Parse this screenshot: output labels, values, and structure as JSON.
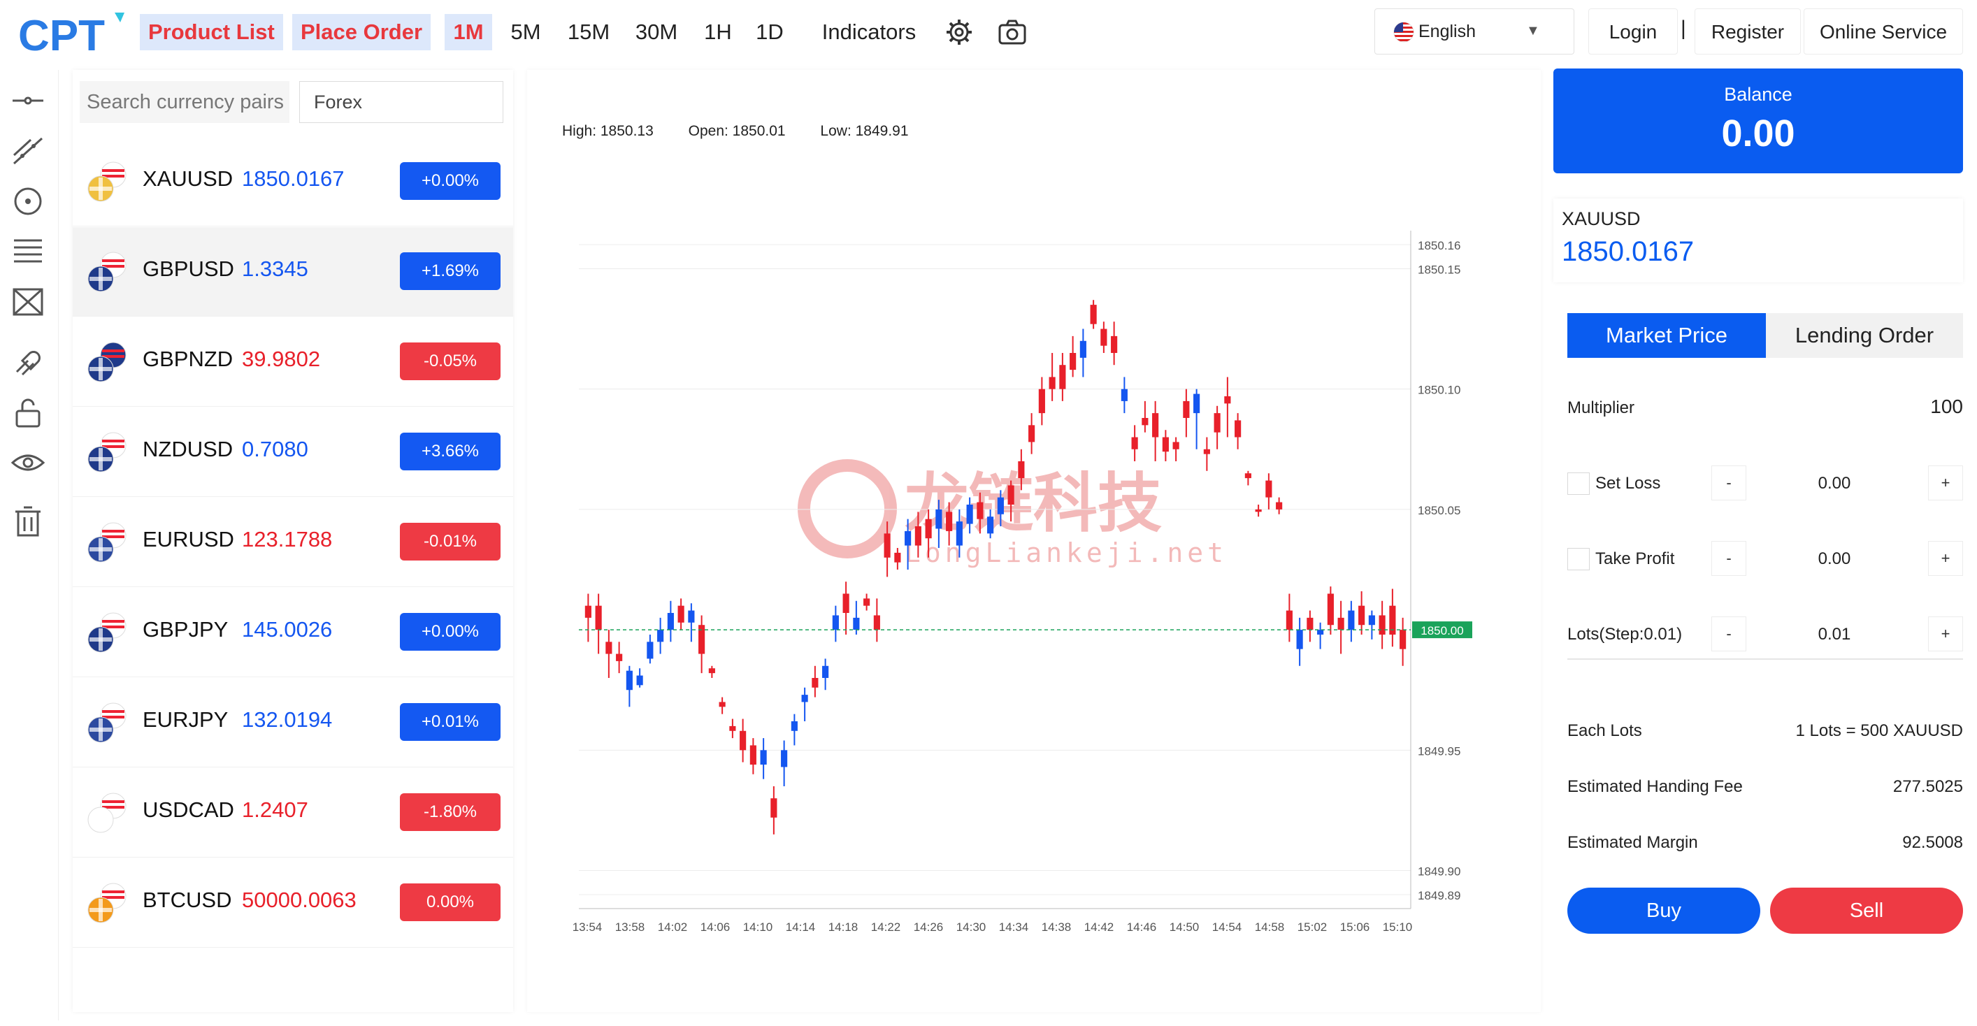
{
  "header": {
    "logo_text": "CPT",
    "nav": [
      "Product List",
      "Place Order"
    ],
    "timeframes": [
      "1M",
      "5M",
      "15M",
      "30M",
      "1H",
      "1D"
    ],
    "active_timeframe": "1M",
    "indicators_label": "Indicators",
    "settings_icon": "gear-icon",
    "snapshot_icon": "camera-icon",
    "language": "English",
    "login": "Login",
    "separator": "|",
    "register": "Register",
    "online_service": "Online Service"
  },
  "toolbar": {
    "tools": [
      "horizontal-line-icon",
      "trend-line-icon",
      "circle-target-icon",
      "fib-lines-icon",
      "pattern-icon",
      "magnet-icon",
      "unlock-icon",
      "eye-icon",
      "trash-icon"
    ]
  },
  "pairs_panel": {
    "search_placeholder": "Search currency pairs",
    "market": "Forex",
    "pairs": [
      {
        "symbol": "XAUUSD",
        "price": "1850.0167",
        "change": "+0.00%",
        "direction": "up",
        "flag_icon": "gold-usd-flag-icon"
      },
      {
        "symbol": "GBPUSD",
        "price": "1.3345",
        "change": "+1.69%",
        "direction": "up",
        "flag_icon": "gbp-usd-flag-icon"
      },
      {
        "symbol": "GBPNZD",
        "price": "39.9802",
        "change": "-0.05%",
        "direction": "down",
        "flag_icon": "gbp-nzd-flag-icon"
      },
      {
        "symbol": "NZDUSD",
        "price": "0.7080",
        "change": "+3.66%",
        "direction": "up",
        "flag_icon": "nzd-usd-flag-icon"
      },
      {
        "symbol": "EURUSD",
        "price": "123.1788",
        "change": "-0.01%",
        "direction": "down",
        "flag_icon": "eur-usd-flag-icon"
      },
      {
        "symbol": "GBPJPY",
        "price": "145.0026",
        "change": "+0.00%",
        "direction": "up",
        "flag_icon": "gbp-jpy-flag-icon"
      },
      {
        "symbol": "EURJPY",
        "price": "132.0194",
        "change": "+0.01%",
        "direction": "up",
        "flag_icon": "eur-jpy-flag-icon"
      },
      {
        "symbol": "USDCAD",
        "price": "1.2407",
        "change": "-1.80%",
        "direction": "down",
        "flag_icon": "usd-cad-flag-icon"
      },
      {
        "symbol": "BTCUSD",
        "price": "50000.0063",
        "change": "0.00%",
        "direction": "down",
        "flag_icon": "btc-usd-flag-icon"
      }
    ]
  },
  "chart": {
    "high": "High: 1850.13",
    "open": "Open: 1850.01",
    "low": "Low: 1849.91",
    "current_price_label": "1850.00",
    "y_ticks": [
      "1850.16",
      "1850.15",
      "1850.10",
      "1850.05",
      "1849.95",
      "1849.90",
      "1849.89"
    ],
    "x_ticks": [
      "13:54",
      "13:58",
      "14:02",
      "14:06",
      "14:10",
      "14:14",
      "14:18",
      "14:22",
      "14:26",
      "14:30",
      "14:34",
      "14:38",
      "14:42",
      "14:46",
      "14:50",
      "14:54",
      "14:58",
      "15:02",
      "15:06",
      "15:10"
    ],
    "watermark_cn": "龙链科技",
    "watermark_en": "LongLiankeji.net",
    "colors": {
      "up": "#1456f0",
      "down": "#e8202a",
      "current": "#1aa35a"
    }
  },
  "chart_data": {
    "type": "candlestick",
    "ylim": [
      1849.89,
      1850.16
    ],
    "current_price": 1850.0,
    "x_range": [
      "13:54",
      "15:12"
    ],
    "candles": [
      {
        "o": 1850.01,
        "c": 1850.005,
        "h": 1850.015,
        "l": 1849.995
      },
      {
        "o": 1850.01,
        "c": 1850.0,
        "h": 1850.015,
        "l": 1849.99
      },
      {
        "o": 1849.995,
        "c": 1849.99,
        "h": 1850.0,
        "l": 1849.98
      },
      {
        "o": 1849.99,
        "c": 1849.987,
        "h": 1849.995,
        "l": 1849.982
      },
      {
        "o": 1849.975,
        "c": 1849.983,
        "h": 1849.985,
        "l": 1849.968
      },
      {
        "o": 1849.977,
        "c": 1849.981,
        "h": 1849.984,
        "l": 1849.976
      },
      {
        "o": 1849.988,
        "c": 1849.995,
        "h": 1849.998,
        "l": 1849.986
      },
      {
        "o": 1849.995,
        "c": 1850.0,
        "h": 1850.005,
        "l": 1849.99
      },
      {
        "o": 1850.0,
        "c": 1850.007,
        "h": 1850.012,
        "l": 1849.995
      },
      {
        "o": 1850.01,
        "c": 1850.003,
        "h": 1850.013,
        "l": 1850.0
      },
      {
        "o": 1850.003,
        "c": 1850.008,
        "h": 1850.011,
        "l": 1849.995
      },
      {
        "o": 1850.002,
        "c": 1849.99,
        "h": 1850.006,
        "l": 1849.982
      },
      {
        "o": 1849.984,
        "c": 1849.982,
        "h": 1849.985,
        "l": 1849.98
      },
      {
        "o": 1849.97,
        "c": 1849.968,
        "h": 1849.972,
        "l": 1849.965
      },
      {
        "o": 1849.96,
        "c": 1849.958,
        "h": 1849.963,
        "l": 1849.955
      },
      {
        "o": 1849.958,
        "c": 1849.95,
        "h": 1849.963,
        "l": 1849.945
      },
      {
        "o": 1849.952,
        "c": 1849.944,
        "h": 1849.955,
        "l": 1849.94
      },
      {
        "o": 1849.944,
        "c": 1849.95,
        "h": 1849.955,
        "l": 1849.938
      },
      {
        "o": 1849.93,
        "c": 1849.922,
        "h": 1849.935,
        "l": 1849.915
      },
      {
        "o": 1849.943,
        "c": 1849.95,
        "h": 1849.954,
        "l": 1849.935
      },
      {
        "o": 1849.958,
        "c": 1849.962,
        "h": 1849.965,
        "l": 1849.952
      },
      {
        "o": 1849.97,
        "c": 1849.973,
        "h": 1849.976,
        "l": 1849.962
      },
      {
        "o": 1849.98,
        "c": 1849.976,
        "h": 1849.985,
        "l": 1849.972
      },
      {
        "o": 1849.98,
        "c": 1849.985,
        "h": 1849.988,
        "l": 1849.975
      },
      {
        "o": 1850.0,
        "c": 1850.006,
        "h": 1850.01,
        "l": 1849.995
      },
      {
        "o": 1850.015,
        "c": 1850.007,
        "h": 1850.02,
        "l": 1849.998
      },
      {
        "o": 1850.0,
        "c": 1850.005,
        "h": 1850.012,
        "l": 1849.998
      },
      {
        "o": 1850.013,
        "c": 1850.01,
        "h": 1850.015,
        "l": 1850.008
      },
      {
        "o": 1850.006,
        "c": 1850.0,
        "h": 1850.013,
        "l": 1849.995
      },
      {
        "o": 1850.04,
        "c": 1850.03,
        "h": 1850.045,
        "l": 1850.022
      },
      {
        "o": 1850.032,
        "c": 1850.028,
        "h": 1850.034,
        "l": 1850.025
      },
      {
        "o": 1850.035,
        "c": 1850.041,
        "h": 1850.046,
        "l": 1850.025
      },
      {
        "o": 1850.043,
        "c": 1850.035,
        "h": 1850.049,
        "l": 1850.03
      },
      {
        "o": 1850.046,
        "c": 1850.038,
        "h": 1850.05,
        "l": 1850.03
      },
      {
        "o": 1850.042,
        "c": 1850.05,
        "h": 1850.054,
        "l": 1850.034
      },
      {
        "o": 1850.049,
        "c": 1850.041,
        "h": 1850.053,
        "l": 1850.035
      },
      {
        "o": 1850.035,
        "c": 1850.045,
        "h": 1850.05,
        "l": 1850.03
      },
      {
        "o": 1850.044,
        "c": 1850.052,
        "h": 1850.055,
        "l": 1850.04
      },
      {
        "o": 1850.053,
        "c": 1850.046,
        "h": 1850.057,
        "l": 1850.04
      },
      {
        "o": 1850.04,
        "c": 1850.047,
        "h": 1850.05,
        "l": 1850.038
      },
      {
        "o": 1850.048,
        "c": 1850.055,
        "h": 1850.058,
        "l": 1850.043
      },
      {
        "o": 1850.06,
        "c": 1850.052,
        "h": 1850.062,
        "l": 1850.045
      },
      {
        "o": 1850.07,
        "c": 1850.063,
        "h": 1850.075,
        "l": 1850.058
      },
      {
        "o": 1850.085,
        "c": 1850.078,
        "h": 1850.09,
        "l": 1850.073
      },
      {
        "o": 1850.1,
        "c": 1850.09,
        "h": 1850.105,
        "l": 1850.085
      },
      {
        "o": 1850.105,
        "c": 1850.1,
        "h": 1850.115,
        "l": 1850.095
      },
      {
        "o": 1850.11,
        "c": 1850.1,
        "h": 1850.115,
        "l": 1850.095
      },
      {
        "o": 1850.115,
        "c": 1850.108,
        "h": 1850.122,
        "l": 1850.105
      },
      {
        "o": 1850.113,
        "c": 1850.12,
        "h": 1850.125,
        "l": 1850.105
      },
      {
        "o": 1850.135,
        "c": 1850.127,
        "h": 1850.137,
        "l": 1850.125
      },
      {
        "o": 1850.125,
        "c": 1850.118,
        "h": 1850.128,
        "l": 1850.115
      },
      {
        "o": 1850.122,
        "c": 1850.115,
        "h": 1850.128,
        "l": 1850.11
      },
      {
        "o": 1850.095,
        "c": 1850.1,
        "h": 1850.105,
        "l": 1850.09
      },
      {
        "o": 1850.08,
        "c": 1850.075,
        "h": 1850.085,
        "l": 1850.07
      },
      {
        "o": 1850.088,
        "c": 1850.085,
        "h": 1850.095,
        "l": 1850.082
      },
      {
        "o": 1850.09,
        "c": 1850.08,
        "h": 1850.095,
        "l": 1850.07
      },
      {
        "o": 1850.08,
        "c": 1850.074,
        "h": 1850.083,
        "l": 1850.07
      },
      {
        "o": 1850.078,
        "c": 1850.075,
        "h": 1850.08,
        "l": 1850.07
      },
      {
        "o": 1850.095,
        "c": 1850.088,
        "h": 1850.1,
        "l": 1850.08
      },
      {
        "o": 1850.09,
        "c": 1850.098,
        "h": 1850.1,
        "l": 1850.075
      },
      {
        "o": 1850.075,
        "c": 1850.073,
        "h": 1850.08,
        "l": 1850.066
      },
      {
        "o": 1850.09,
        "c": 1850.082,
        "h": 1850.093,
        "l": 1850.075
      },
      {
        "o": 1850.097,
        "c": 1850.094,
        "h": 1850.105,
        "l": 1850.08
      },
      {
        "o": 1850.087,
        "c": 1850.08,
        "h": 1850.09,
        "l": 1850.075
      },
      {
        "o": 1850.065,
        "c": 1850.063,
        "h": 1850.066,
        "l": 1850.06
      },
      {
        "o": 1850.05,
        "c": 1850.049,
        "h": 1850.052,
        "l": 1850.047
      },
      {
        "o": 1850.062,
        "c": 1850.055,
        "h": 1850.065,
        "l": 1850.05
      },
      {
        "o": 1850.053,
        "c": 1850.05,
        "h": 1850.055,
        "l": 1850.048
      },
      {
        "o": 1850.008,
        "c": 1850.0,
        "h": 1850.015,
        "l": 1849.995
      },
      {
        "o": 1849.992,
        "c": 1850.0,
        "h": 1850.005,
        "l": 1849.985
      },
      {
        "o": 1850.005,
        "c": 1850.0,
        "h": 1850.008,
        "l": 1849.995
      },
      {
        "o": 1849.998,
        "c": 1850.0,
        "h": 1850.003,
        "l": 1849.992
      },
      {
        "o": 1850.015,
        "c": 1850.002,
        "h": 1850.018,
        "l": 1849.998
      },
      {
        "o": 1850.005,
        "c": 1850.0,
        "h": 1850.012,
        "l": 1849.99
      },
      {
        "o": 1850.0,
        "c": 1850.008,
        "h": 1850.012,
        "l": 1849.995
      },
      {
        "o": 1850.01,
        "c": 1850.002,
        "h": 1850.016,
        "l": 1849.998
      },
      {
        "o": 1850.002,
        "c": 1850.006,
        "h": 1850.008,
        "l": 1849.996
      },
      {
        "o": 1850.006,
        "c": 1849.998,
        "h": 1850.012,
        "l": 1849.992
      },
      {
        "o": 1850.01,
        "c": 1849.998,
        "h": 1850.017,
        "l": 1849.993
      },
      {
        "o": 1850.0,
        "c": 1849.992,
        "h": 1850.005,
        "l": 1849.985
      }
    ]
  },
  "account": {
    "balance_label": "Balance",
    "balance": "0.00",
    "symbol": "XAUUSD",
    "price": "1850.0167"
  },
  "order": {
    "tabs": [
      "Market Price",
      "Lending Order"
    ],
    "multiplier_label": "Multiplier",
    "multiplier": "100",
    "set_loss_label": "Set Loss",
    "set_loss": "0.00",
    "take_profit_label": "Take Profit",
    "take_profit": "0.00",
    "lots_label": "Lots(Step:0.01)",
    "lots": "0.01",
    "minus": "-",
    "plus": "+",
    "each_lots_label": "Each Lots",
    "each_lots": "1 Lots = 500 XAUUSD",
    "fee_label": "Estimated Handing Fee",
    "fee": "277.5025",
    "margin_label": "Estimated Margin",
    "margin": "92.5008",
    "buy": "Buy",
    "sell": "Sell",
    "colors": {
      "buy": "#0a5cf0",
      "sell": "#ee3a44"
    }
  }
}
